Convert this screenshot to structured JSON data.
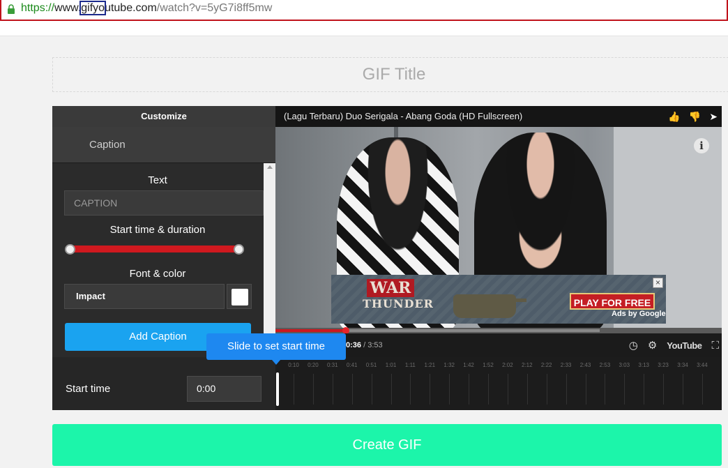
{
  "browser": {
    "url_protocol": "https://",
    "url_prefix": "www.",
    "url_highlight": "gifyo",
    "url_host_rest": "utube.com",
    "url_path": "/watch?v=5yG7i8ff5mw"
  },
  "title": {
    "placeholder": "GIF Title"
  },
  "customize": {
    "header": "Customize",
    "tab": "Caption",
    "text_label": "Text",
    "caption_placeholder": "CAPTION",
    "timing_label": "Start time & duration",
    "font_label": "Font & color",
    "font_value": "Impact",
    "add_caption": "Add Caption"
  },
  "video": {
    "title": "(Lagu Terbaru) Duo Serigala - Abang Goda (HD Fullscreen)",
    "current_time": "0:36",
    "duration": "3:53",
    "progress_fraction": 0.16,
    "yt_logo": "YouTube"
  },
  "ad": {
    "brand_top": "WAR",
    "brand_bottom": "THUNDER",
    "cta": "PLAY FOR FREE",
    "ads_by": "Ads by Google"
  },
  "timeline": {
    "tooltip": "Slide to set start time",
    "start_label": "Start time",
    "start_value": "0:00",
    "ticks": [
      "0:10",
      "0:20",
      "0:31",
      "0:41",
      "0:51",
      "1:01",
      "1:11",
      "1:21",
      "1:32",
      "1:42",
      "1:52",
      "2:02",
      "2:12",
      "2:22",
      "2:33",
      "2:43",
      "2:53",
      "3:03",
      "3:13",
      "3:23",
      "3:34",
      "3:44"
    ]
  },
  "create_button": "Create GIF",
  "colors": {
    "accent_red": "#d0191f",
    "button_blue": "#1aa3f0",
    "create_green": "#1cf5aa"
  }
}
